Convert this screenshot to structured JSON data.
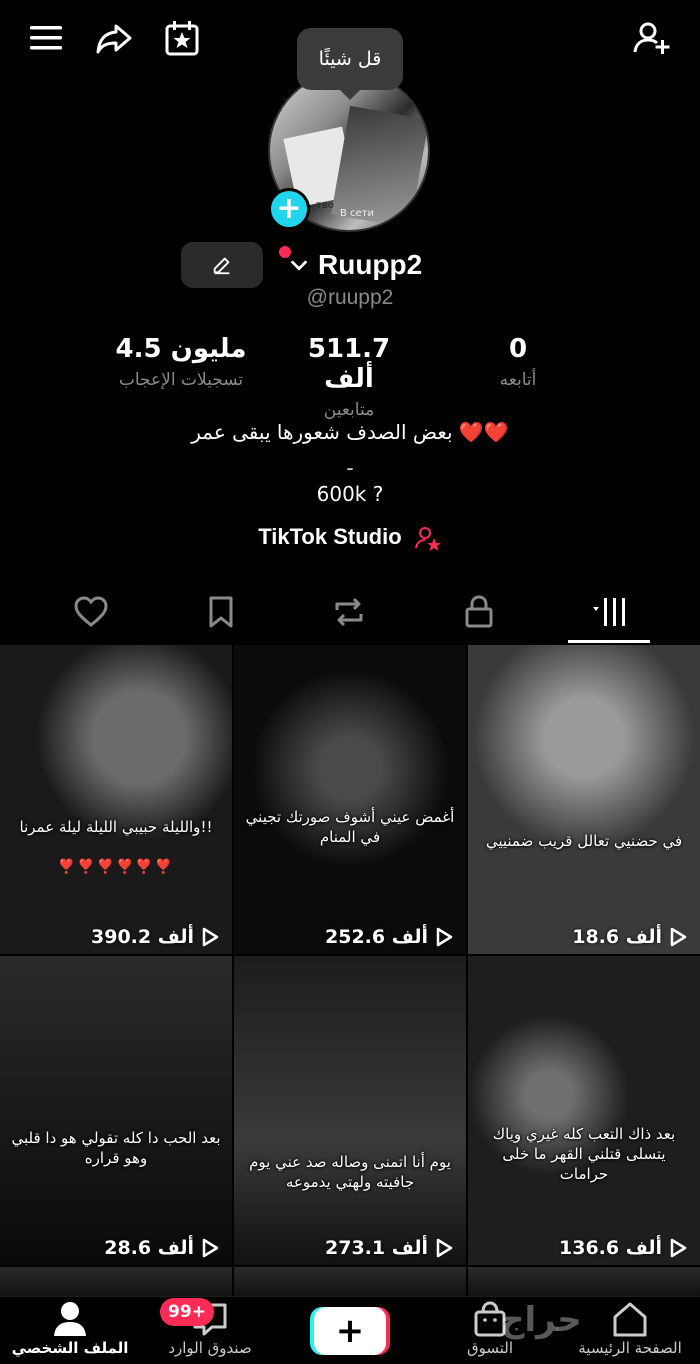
{
  "tooltip": "قل شيئًا",
  "profile": {
    "name": "Ruupp2",
    "handle": "@ruupp2",
    "avatar_texts": [
      "тво",
      "В сети"
    ]
  },
  "stats": {
    "likes": {
      "value": "4.5 مليون",
      "label": "تسجيلات الإعجاب"
    },
    "followers": {
      "value": "511.7 ألف",
      "label": "متابعين"
    },
    "following": {
      "value": "0",
      "label": "أتابعه"
    }
  },
  "bio": {
    "line1": "بعض الصدف شعورها يبقى عمر ❤️❤️",
    "line2": "-",
    "line3": "600k ?"
  },
  "studio": {
    "label": "TikTok Studio"
  },
  "videos": [
    {
      "caption": "والليلة حبيبي الليلة ليلة عمرنا!!",
      "hearts": "❣️❣️❣️❣️❣️❣️",
      "views": "390.2 ألف"
    },
    {
      "caption": "أغمض عيني أشوف صورتك تجيني في المنام",
      "views": "252.6 ألف"
    },
    {
      "caption": "في حضنيي تعالل قريب ضمنييي",
      "views": "18.6 ألف"
    },
    {
      "caption": "بعد الحب دا كله تقولي هو دا قلبي وهو قراره",
      "views": "28.6 ألف"
    },
    {
      "caption": "يوم أنا اتمنى وصاله صد عني يوم جافيته ولهتي يدموعه",
      "views": "273.1 ألف"
    },
    {
      "caption": "بعد ذاك التعب كله غيري وياك يتسلى قتلني القهر ما خلى حرامات",
      "views": "136.6 ألف"
    }
  ],
  "nav": {
    "home": "الصفحة الرئيسية",
    "shop": "التسوق",
    "inbox": "صندوق الوارد",
    "inbox_badge": "99+",
    "profile": "الملف الشخصي"
  },
  "watermark": "حراج",
  "colors": {
    "accent": "#fe2c55",
    "cyan": "#25f4ee",
    "avatar_plus": "#20d5ec"
  }
}
